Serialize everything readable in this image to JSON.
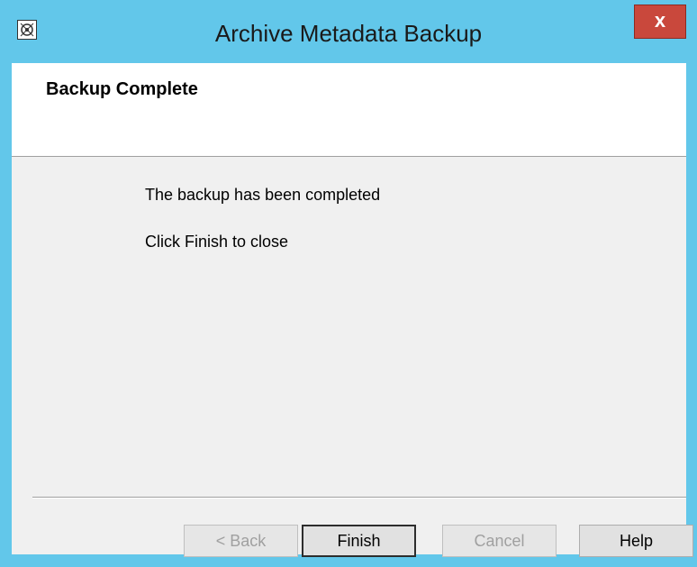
{
  "window": {
    "title": "Archive Metadata Backup",
    "close_label": "x"
  },
  "header": {
    "title": "Backup Complete"
  },
  "body": {
    "message_line1": "The backup has been completed",
    "message_line2": "Click Finish to close"
  },
  "buttons": {
    "back_label": "< Back",
    "finish_label": "Finish",
    "cancel_label": "Cancel",
    "help_label": "Help"
  },
  "icons": {
    "app": "app-icon",
    "close": "close-icon"
  },
  "colors": {
    "titlebar": "#62c7ea",
    "close_button": "#c9483c"
  }
}
